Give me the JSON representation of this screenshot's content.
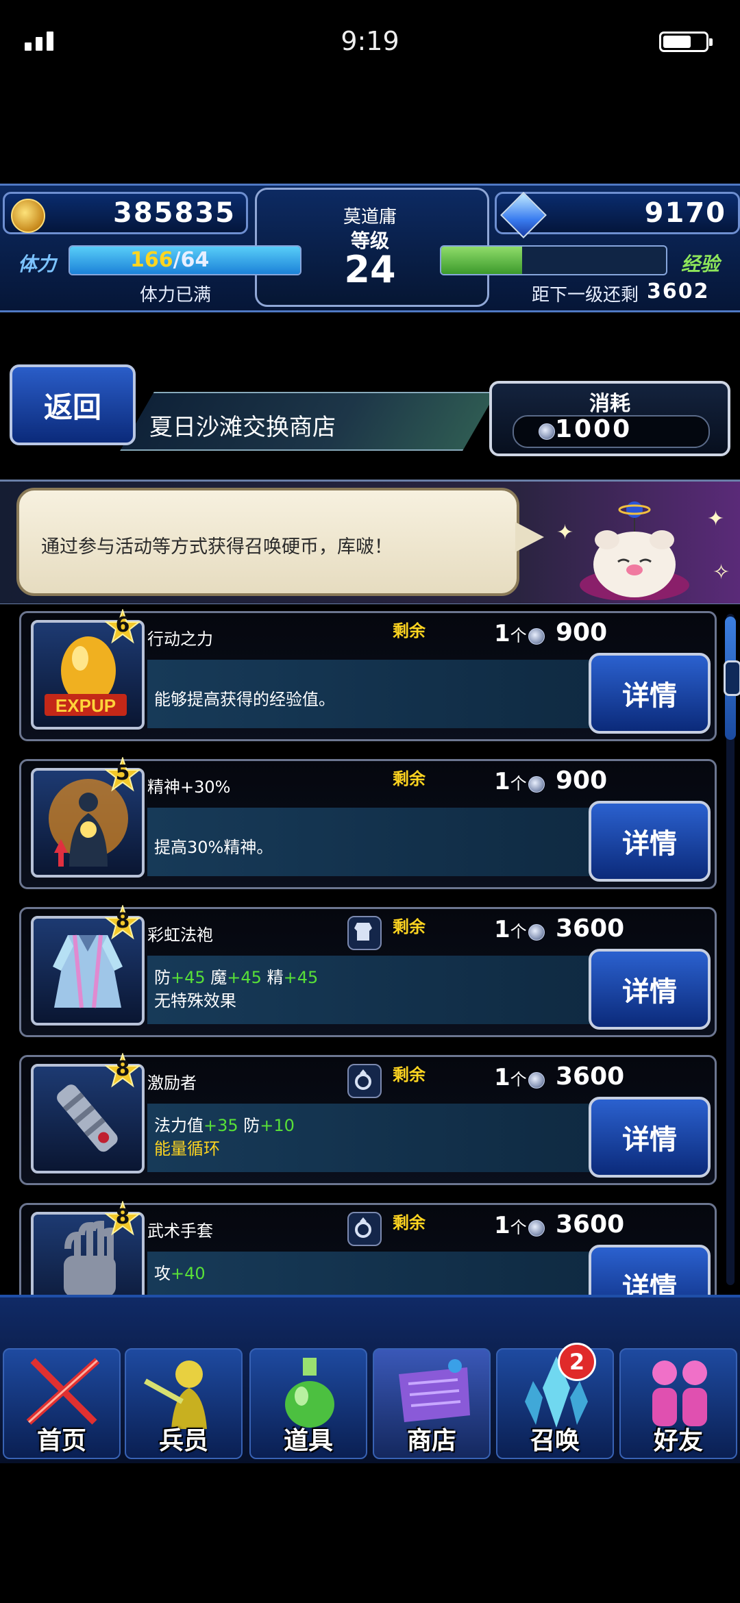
{
  "status_bar": {
    "time": "9:19"
  },
  "header": {
    "gil": "385835",
    "gems": "9170",
    "player_name": "莫道庸",
    "level_label": "等级",
    "level": "24",
    "stamina_label": "体力",
    "stamina_current": "166",
    "stamina_max": "/64",
    "stamina_status": "体力已满",
    "stamina_fill": 1.0,
    "exp_label": "经验",
    "exp_next_label": "距下一级还剩",
    "exp_next_value": "3602",
    "exp_fill": 0.36
  },
  "shop": {
    "back_label": "返回",
    "title": "夏日沙滩交换商店",
    "cost_label": "消耗",
    "cost_value": "1000"
  },
  "banner": {
    "message": "通过参与活动等方式获得召唤硬币，库啵！"
  },
  "items": [
    {
      "rarity": "6",
      "name": "行动之力",
      "remain_label": "剩余",
      "qty": "1",
      "qty_unit": "个",
      "price": "900",
      "desc_line1": "能够提高获得的经验值。",
      "detail_label": "详情"
    },
    {
      "rarity": "5",
      "name": "精神+30%",
      "remain_label": "剩余",
      "qty": "1",
      "qty_unit": "个",
      "price": "900",
      "desc_line1": "提高30%精神。",
      "detail_label": "详情"
    },
    {
      "rarity": "8",
      "name": "彩虹法袍",
      "remain_label": "剩余",
      "qty": "1",
      "qty_unit": "个",
      "price": "3600",
      "stat1_label": "防",
      "stat1_value": "+45",
      "stat2_label": "魔",
      "stat2_value": "+45",
      "stat3_label": "精",
      "stat3_value": "+45",
      "desc_line2": "无特殊效果",
      "detail_label": "详情"
    },
    {
      "rarity": "8",
      "name": "激励者",
      "remain_label": "剩余",
      "qty": "1",
      "qty_unit": "个",
      "price": "3600",
      "stat1_label": "法力值",
      "stat1_value": "+35",
      "stat2_label": "防",
      "stat2_value": "+10",
      "desc_line2": "能量循环",
      "detail_label": "详情"
    },
    {
      "rarity": "8",
      "name": "武术手套",
      "remain_label": "剩余",
      "qty": "1",
      "qty_unit": "个",
      "price": "3600",
      "stat1_label": "攻",
      "stat1_value": "+40",
      "detail_label": "详情"
    }
  ],
  "nav": {
    "home": "首页",
    "units": "兵员",
    "items": "道具",
    "shop": "商店",
    "summon": "召唤",
    "summon_badge": "2",
    "friends": "好友"
  }
}
